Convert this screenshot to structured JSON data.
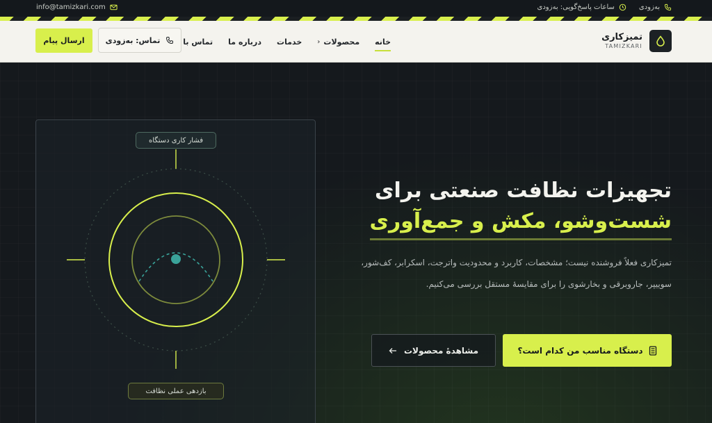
{
  "topbar": {
    "email": "info@tamizkari.com",
    "phone": "به‌زودی",
    "hours": "ساعات پاسخ‌گویی: به‌زودی"
  },
  "header": {
    "logo_title": "تمیزکاری",
    "logo_sub": "TAMIZKARI",
    "nav": [
      {
        "label": "خانه",
        "active": true
      },
      {
        "label": "محصولات",
        "has_chevron": true
      },
      {
        "label": "خدمات"
      },
      {
        "label": "درباره ما"
      },
      {
        "label": "تماس با ما"
      }
    ],
    "call_label": "تماس: به‌زودی",
    "send_label": "ارسال پیام"
  },
  "hero": {
    "title_line1": "تجهیزات نظافت صنعتی برای",
    "title_line2": "شست‌وشو، مکش و جمع‌آوری",
    "description": "تمیزکاری فعلاً فروشنده نیست؛ مشخصات، کاربرد و محدودیت واترجت، اسکرابر، کف‌شور، سوییپر، جاروبرقی و بخارشوی را برای مقایسهٔ مستقل بررسی می‌کنیم.",
    "cta_primary": "دستگاه مناسب من کدام است؟",
    "cta_secondary": "مشاهدهٔ محصولات",
    "panel_label_top": "فشار کاری دستگاه",
    "panel_label_bottom": "بازدهی عملی نظافت"
  },
  "colors": {
    "accent": "#d8ef4c",
    "dark": "#15191d",
    "header_bg": "#f4f3ee",
    "teal": "#3aa39a"
  },
  "icons": {
    "email": "mail-icon",
    "phone": "phone-icon",
    "clock": "clock-icon",
    "logo": "drop-icon",
    "cta": "calculator-icon",
    "arrow": "arrow-left-icon"
  }
}
